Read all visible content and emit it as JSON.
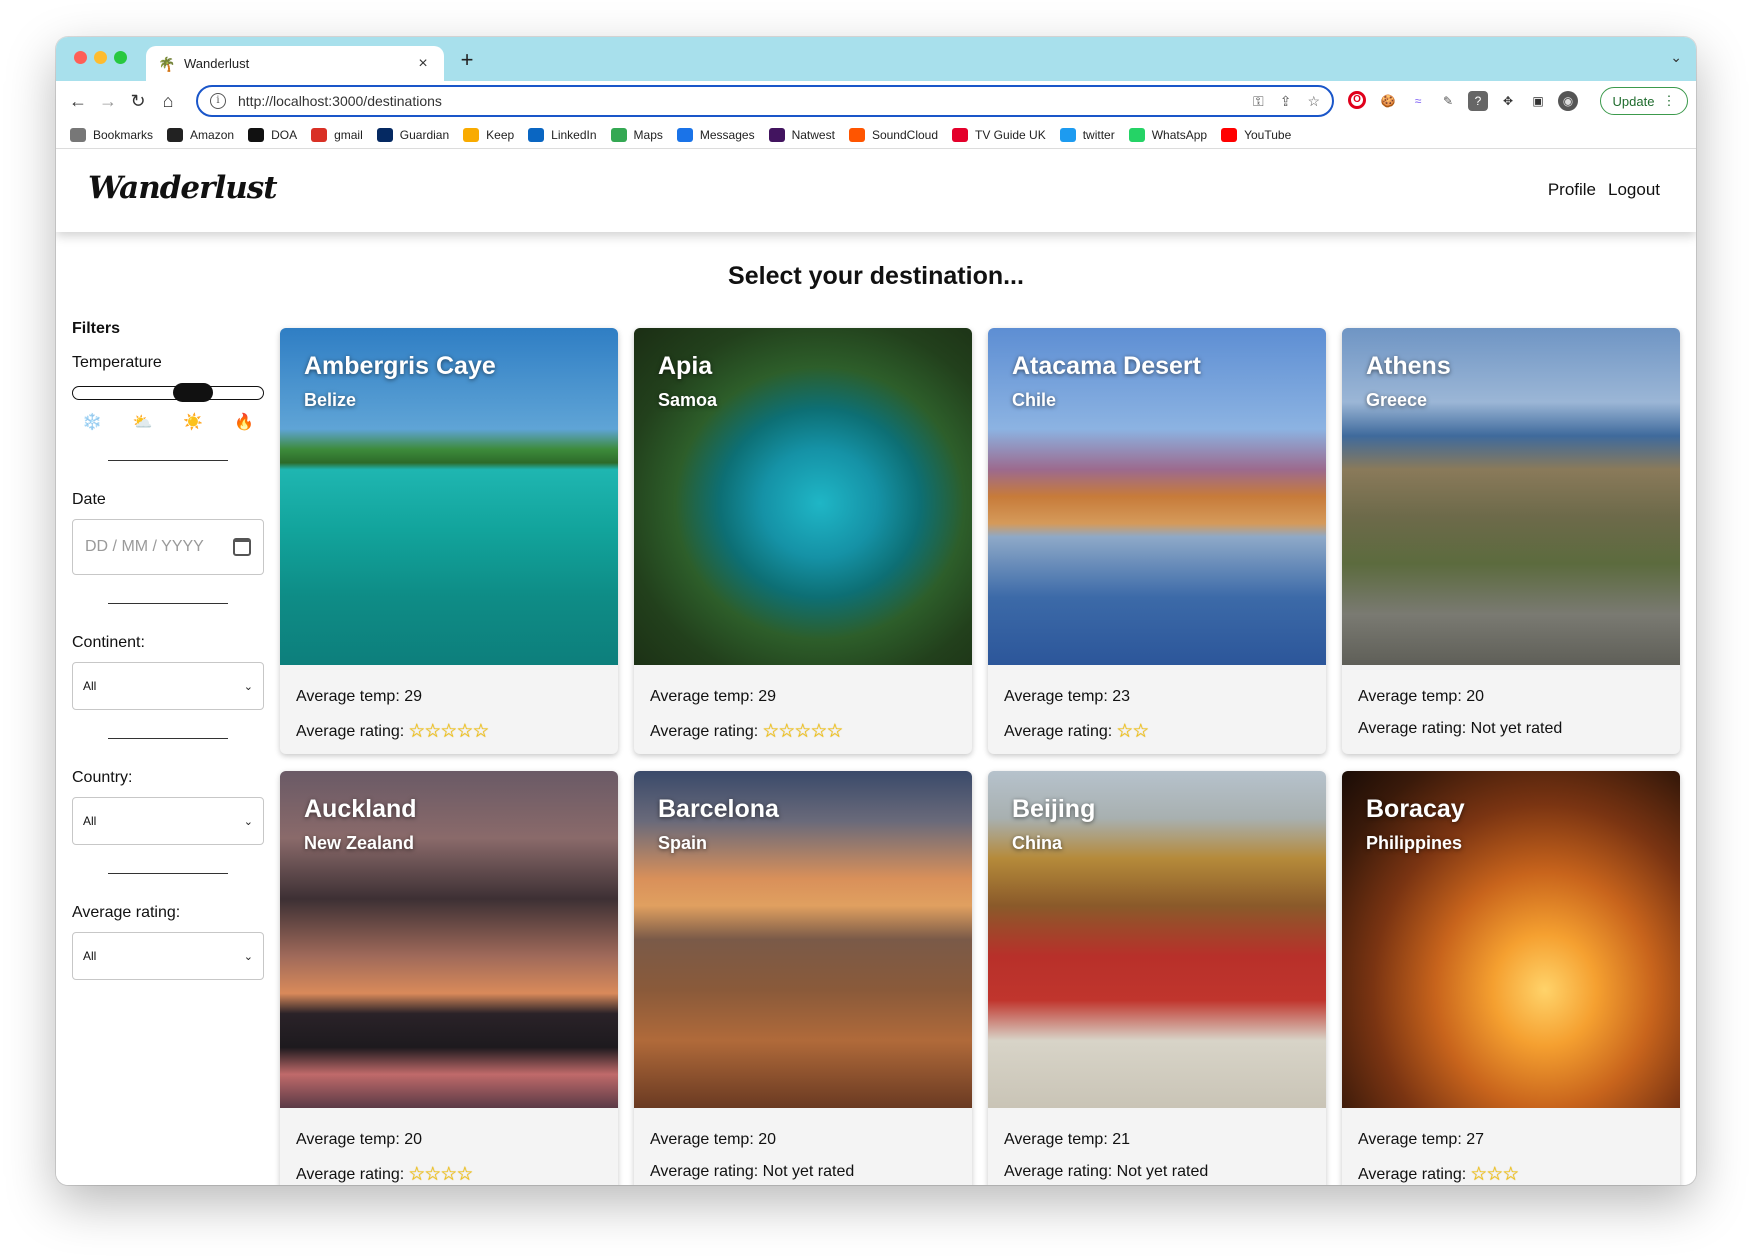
{
  "browser": {
    "tab_title": "Wanderlust",
    "tab_close": "×",
    "new_tab": "+",
    "url": "http://localhost:3000/destinations",
    "update_label": "Update",
    "bookmarks": [
      {
        "label": "Bookmarks",
        "icon": "folder-icon",
        "color": "#777777"
      },
      {
        "label": "Amazon",
        "icon": "amazon-icon",
        "color": "#222222"
      },
      {
        "label": "DOA",
        "icon": "doa-icon",
        "color": "#111111"
      },
      {
        "label": "gmail",
        "icon": "gmail-icon",
        "color": "#d93025"
      },
      {
        "label": "Guardian",
        "icon": "guardian-icon",
        "color": "#052962"
      },
      {
        "label": "Keep",
        "icon": "keep-icon",
        "color": "#f9ab00"
      },
      {
        "label": "LinkedIn",
        "icon": "linkedin-icon",
        "color": "#0a66c2"
      },
      {
        "label": "Maps",
        "icon": "maps-icon",
        "color": "#34a853"
      },
      {
        "label": "Messages",
        "icon": "messages-icon",
        "color": "#1a73e8"
      },
      {
        "label": "Natwest",
        "icon": "natwest-icon",
        "color": "#42145f"
      },
      {
        "label": "SoundCloud",
        "icon": "soundcloud-icon",
        "color": "#ff5500"
      },
      {
        "label": "TV Guide UK",
        "icon": "tvguide-icon",
        "color": "#e4002b"
      },
      {
        "label": "twitter",
        "icon": "twitter-icon",
        "color": "#1d9bf0"
      },
      {
        "label": "WhatsApp",
        "icon": "whatsapp-icon",
        "color": "#25d366"
      },
      {
        "label": "YouTube",
        "icon": "youtube-icon",
        "color": "#ff0000"
      }
    ]
  },
  "app": {
    "brand": "Wanderlust",
    "nav": {
      "profile": "Profile",
      "logout": "Logout"
    },
    "heading": "Select your destination..."
  },
  "filters": {
    "title": "Filters",
    "temperature_label": "Temperature",
    "temperature_value": 0.63,
    "temperature_icons": [
      "❄️",
      "⛅",
      "☀️",
      "🔥"
    ],
    "date_label": "Date",
    "date_placeholder": "DD / MM / YYYY",
    "continent_label": "Continent:",
    "continent_value": "All",
    "country_label": "Country:",
    "country_value": "All",
    "rating_label": "Average rating:",
    "rating_value": "All"
  },
  "destinations": [
    {
      "name": "Ambergris Caye",
      "country": "Belize",
      "temp": "Average temp: 29",
      "rating_label": "Average rating:",
      "stars": "☆☆☆☆☆",
      "image": "img-belize"
    },
    {
      "name": "Apia",
      "country": "Samoa",
      "temp": "Average temp: 29",
      "rating_label": "Average rating:",
      "stars": "☆☆☆☆☆",
      "image": "img-samoa"
    },
    {
      "name": "Atacama Desert",
      "country": "Chile",
      "temp": "Average temp: 23",
      "rating_label": "Average rating:",
      "stars": "☆☆",
      "image": "img-atacama"
    },
    {
      "name": "Athens",
      "country": "Greece",
      "temp": "Average temp: 20",
      "rating_label": "Average rating: Not yet rated",
      "stars": "",
      "image": "img-athens"
    },
    {
      "name": "Auckland",
      "country": "New Zealand",
      "temp": "Average temp: 20",
      "rating_label": "Average rating:",
      "stars": "☆☆☆☆",
      "image": "img-auckland"
    },
    {
      "name": "Barcelona",
      "country": "Spain",
      "temp": "Average temp: 20",
      "rating_label": "Average rating: Not yet rated",
      "stars": "",
      "image": "img-barcelona"
    },
    {
      "name": "Beijing",
      "country": "China",
      "temp": "Average temp: 21",
      "rating_label": "Average rating: Not yet rated",
      "stars": "",
      "image": "img-beijing"
    },
    {
      "name": "Boracay",
      "country": "Philippines",
      "temp": "Average temp: 27",
      "rating_label": "Average rating:",
      "stars": "☆☆☆",
      "image": "img-boracay"
    }
  ]
}
